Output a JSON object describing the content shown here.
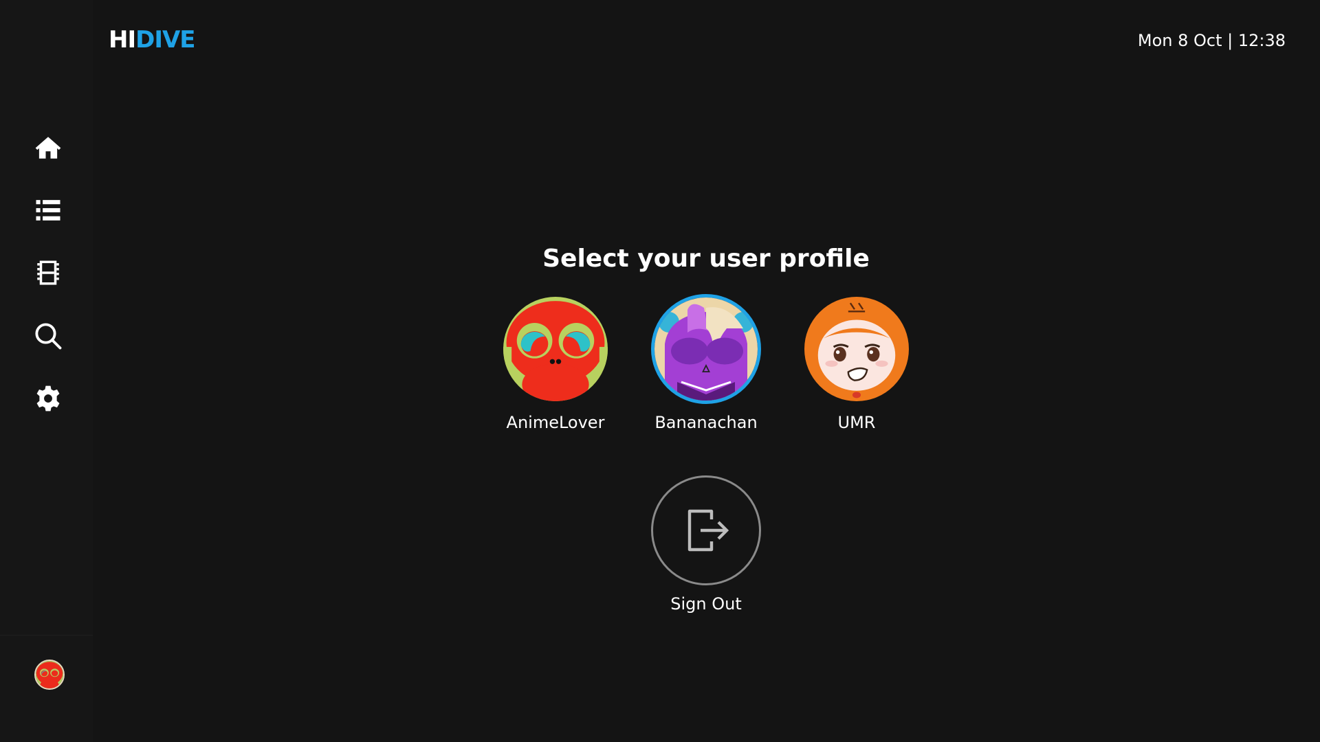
{
  "header": {
    "logo_hi": "HI",
    "logo_dive": "DIVE",
    "datetime": "Mon 8 Oct | 12:38"
  },
  "sidebar": {
    "items": [
      {
        "icon": "home-icon"
      },
      {
        "icon": "list-icon"
      },
      {
        "icon": "film-icon"
      },
      {
        "icon": "search-icon"
      },
      {
        "icon": "gear-icon"
      }
    ],
    "current_user_avatar": "monkey-avatar"
  },
  "main": {
    "title": "Select your user profile",
    "profiles": [
      {
        "name": "AnimeLover",
        "avatar": "monkey-avatar",
        "selected": false
      },
      {
        "name": "Bananachan",
        "avatar": "purple-character-avatar",
        "selected": true
      },
      {
        "name": "UMR",
        "avatar": "tiger-hood-girl-avatar",
        "selected": false
      }
    ],
    "signout": {
      "label": "Sign Out",
      "icon": "sign-out-icon"
    }
  },
  "colors": {
    "accent": "#1fa2e6",
    "background": "#141414",
    "sidebar": "#161616",
    "signout_ring": "#8a8a8a"
  }
}
